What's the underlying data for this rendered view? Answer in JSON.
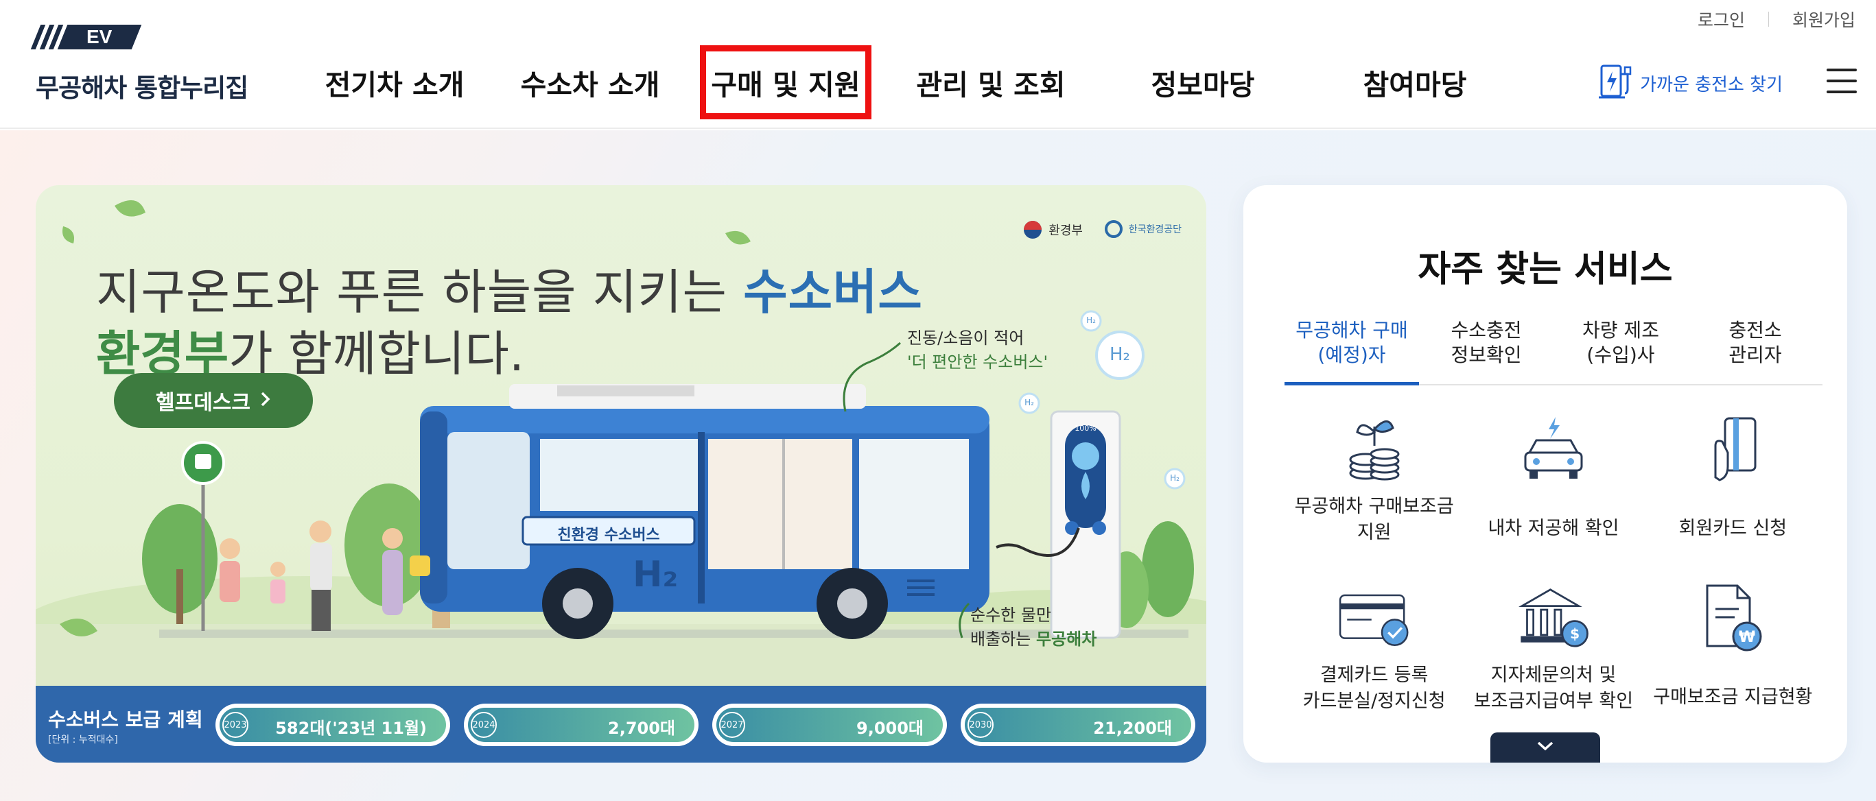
{
  "header": {
    "logo_badge": "EV",
    "logo_text": "무공해차 통합누리집",
    "util_links": {
      "login": "로그인",
      "signup": "회원가입"
    },
    "nav": [
      {
        "label": "전기차 소개"
      },
      {
        "label": "수소차 소개"
      },
      {
        "label": "구매 및 지원",
        "highlighted": true
      },
      {
        "label": "관리 및 조회"
      },
      {
        "label": "정보마당"
      },
      {
        "label": "참여마당"
      }
    ],
    "find_station_label": "가까운 충전소 찾기",
    "highlight_color": "#ee1111",
    "accent_color": "#1d5fd2"
  },
  "banner": {
    "headline_plain": "지구온도와 푸른 하늘을 지키는 ",
    "headline_emph": "수소버스",
    "sub_emph": "환경부",
    "sub_plain": "가 함께합니다.",
    "help_button": "헬프데스크",
    "agencies": {
      "ministry": "환경부",
      "corp": "한국환경공단"
    },
    "callout_1_line1": "진동/소음이 적어",
    "callout_1_line2": "'더 편안한 수소버스'",
    "callout_2_line1": "순수한 물만",
    "callout_2_line2_plain": "배출하는 ",
    "callout_2_line2_emph": "무공해차",
    "bus_label": "친환경 수소버스",
    "bus_h2": "H₂",
    "h2_bubbles": [
      "H₂",
      "H₂",
      "H₂",
      "H₂"
    ],
    "charger_level": "100%",
    "bus_stop_icon": "bus-icon",
    "stats_title": "수소버스 보급 계획",
    "stats_unit": "[단위 : 누적대수]",
    "stats": [
      {
        "year": "2023",
        "value": "582대('23년 11월)"
      },
      {
        "year": "2024",
        "value": "2,700대"
      },
      {
        "year": "2027",
        "value": "9,000대"
      },
      {
        "year": "2030",
        "value": "21,200대"
      }
    ]
  },
  "services": {
    "title": "자주 찾는 서비스",
    "tabs": [
      {
        "label": "무공해차 구매\n(예정)자",
        "active": true
      },
      {
        "label": "수소충전\n정보확인"
      },
      {
        "label": "차량 제조\n(수입)사"
      },
      {
        "label": "충전소\n관리자"
      }
    ],
    "items": [
      {
        "label": "무공해차 구매보조금\n지원",
        "icon": "coins-sprout-icon"
      },
      {
        "label": "내차 저공해 확인",
        "icon": "car-electric-icon"
      },
      {
        "label": "회원카드 신청",
        "icon": "card-hand-icon"
      },
      {
        "label": "결제카드 등록\n카드분실/정지신청",
        "icon": "card-check-icon"
      },
      {
        "label": "지자체문의처 및\n보조금지급여부 확인",
        "icon": "bank-dollar-icon"
      },
      {
        "label": "구매보조금 지급현황",
        "icon": "document-won-icon"
      }
    ]
  }
}
